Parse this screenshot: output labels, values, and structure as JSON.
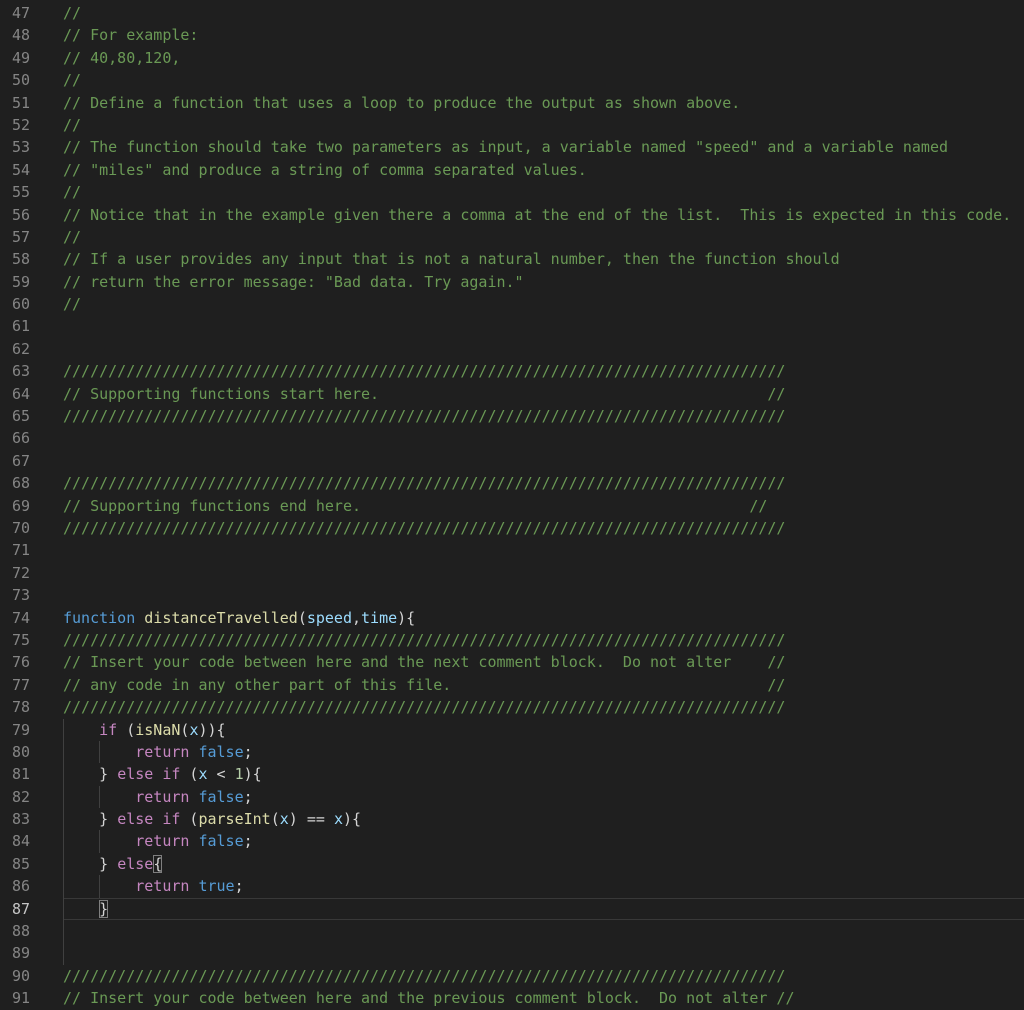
{
  "editor": {
    "language": "javascript",
    "active_line": 87,
    "colors": {
      "comment": "#6A9955",
      "kw": "#C586C0",
      "kw2": "#569CD6",
      "fn": "#DCDCAA",
      "var": "#9CDCFE",
      "num": "#B5CEA8",
      "punct": "#D4D4D4",
      "background": "#1F1F1F",
      "line_number": "#858585",
      "line_number_active": "#C6C6C6",
      "indent_guide": "#404040",
      "current_line_border": "#383838",
      "bracket_match_border": "#7F7F7F"
    },
    "first_visible_line": 47,
    "last_visible_line": 91,
    "lines": [
      {
        "n": 47,
        "g": [],
        "segs": [
          {
            "t": "//",
            "c": "comment"
          }
        ]
      },
      {
        "n": 48,
        "g": [],
        "segs": [
          {
            "t": "// For example:",
            "c": "comment"
          }
        ]
      },
      {
        "n": 49,
        "g": [],
        "segs": [
          {
            "t": "// 40,80,120,",
            "c": "comment"
          }
        ]
      },
      {
        "n": 50,
        "g": [],
        "segs": [
          {
            "t": "//",
            "c": "comment"
          }
        ]
      },
      {
        "n": 51,
        "g": [],
        "segs": [
          {
            "t": "// Define a function that uses a loop to produce the output as shown above.",
            "c": "comment"
          }
        ]
      },
      {
        "n": 52,
        "g": [],
        "segs": [
          {
            "t": "//",
            "c": "comment"
          }
        ]
      },
      {
        "n": 53,
        "g": [],
        "segs": [
          {
            "t": "// The function should take two parameters as input, a variable named \"speed\" and a variable named",
            "c": "comment"
          }
        ]
      },
      {
        "n": 54,
        "g": [],
        "segs": [
          {
            "t": "// \"miles\" and produce a string of comma separated values.",
            "c": "comment"
          }
        ]
      },
      {
        "n": 55,
        "g": [],
        "segs": [
          {
            "t": "//",
            "c": "comment"
          }
        ]
      },
      {
        "n": 56,
        "g": [],
        "segs": [
          {
            "t": "// Notice that in the example given there a comma at the end of the list.  This is expected in this code.",
            "c": "comment"
          }
        ]
      },
      {
        "n": 57,
        "g": [],
        "segs": [
          {
            "t": "//",
            "c": "comment"
          }
        ]
      },
      {
        "n": 58,
        "g": [],
        "segs": [
          {
            "t": "// If a user provides any input that is not a natural number, then the function should",
            "c": "comment"
          }
        ]
      },
      {
        "n": 59,
        "g": [],
        "segs": [
          {
            "t": "// return the error message: \"Bad data. Try again.\"",
            "c": "comment"
          }
        ]
      },
      {
        "n": 60,
        "g": [],
        "segs": [
          {
            "t": "//",
            "c": "comment"
          }
        ]
      },
      {
        "n": 61,
        "g": [],
        "segs": []
      },
      {
        "n": 62,
        "g": [],
        "segs": []
      },
      {
        "n": 63,
        "g": [],
        "segs": [
          {
            "t": "////////////////////////////////////////////////////////////////////////////////",
            "c": "comment"
          }
        ]
      },
      {
        "n": 64,
        "g": [],
        "segs": [
          {
            "t": "// Supporting functions start here.                                           //",
            "c": "comment"
          }
        ]
      },
      {
        "n": 65,
        "g": [],
        "segs": [
          {
            "t": "////////////////////////////////////////////////////////////////////////////////",
            "c": "comment"
          }
        ]
      },
      {
        "n": 66,
        "g": [],
        "segs": []
      },
      {
        "n": 67,
        "g": [],
        "segs": []
      },
      {
        "n": 68,
        "g": [],
        "segs": [
          {
            "t": "////////////////////////////////////////////////////////////////////////////////",
            "c": "comment"
          }
        ]
      },
      {
        "n": 69,
        "g": [],
        "segs": [
          {
            "t": "// Supporting functions end here.                                           //",
            "c": "comment"
          }
        ]
      },
      {
        "n": 70,
        "g": [],
        "segs": [
          {
            "t": "////////////////////////////////////////////////////////////////////////////////",
            "c": "comment"
          }
        ]
      },
      {
        "n": 71,
        "g": [],
        "segs": []
      },
      {
        "n": 72,
        "g": [],
        "segs": []
      },
      {
        "n": 73,
        "g": [],
        "segs": []
      },
      {
        "n": 74,
        "g": [],
        "segs": [
          {
            "t": "function",
            "c": "kw2"
          },
          {
            "t": " ",
            "c": "punct"
          },
          {
            "t": "distanceTravelled",
            "c": "fn"
          },
          {
            "t": "(",
            "c": "punct"
          },
          {
            "t": "speed",
            "c": "var"
          },
          {
            "t": ",",
            "c": "punct"
          },
          {
            "t": "time",
            "c": "var"
          },
          {
            "t": "){",
            "c": "punct"
          }
        ]
      },
      {
        "n": 75,
        "g": [],
        "segs": [
          {
            "t": "////////////////////////////////////////////////////////////////////////////////",
            "c": "comment"
          }
        ]
      },
      {
        "n": 76,
        "g": [],
        "segs": [
          {
            "t": "// Insert your code between here and the next comment block.  Do not alter    //",
            "c": "comment"
          }
        ]
      },
      {
        "n": 77,
        "g": [],
        "segs": [
          {
            "t": "// any code in any other part of this file.                                   //",
            "c": "comment"
          }
        ]
      },
      {
        "n": 78,
        "g": [],
        "segs": [
          {
            "t": "////////////////////////////////////////////////////////////////////////////////",
            "c": "comment"
          }
        ]
      },
      {
        "n": 79,
        "g": [
          0
        ],
        "segs": [
          {
            "t": "    ",
            "c": "punct"
          },
          {
            "t": "if",
            "c": "kw"
          },
          {
            "t": " (",
            "c": "punct"
          },
          {
            "t": "isNaN",
            "c": "fn"
          },
          {
            "t": "(",
            "c": "punct"
          },
          {
            "t": "x",
            "c": "var"
          },
          {
            "t": ")){",
            "c": "punct"
          }
        ]
      },
      {
        "n": 80,
        "g": [
          0,
          4
        ],
        "segs": [
          {
            "t": "        ",
            "c": "punct"
          },
          {
            "t": "return",
            "c": "kw"
          },
          {
            "t": " ",
            "c": "punct"
          },
          {
            "t": "false",
            "c": "kw2"
          },
          {
            "t": ";",
            "c": "punct"
          }
        ]
      },
      {
        "n": 81,
        "g": [
          0
        ],
        "segs": [
          {
            "t": "    } ",
            "c": "punct"
          },
          {
            "t": "else",
            "c": "kw"
          },
          {
            "t": " ",
            "c": "punct"
          },
          {
            "t": "if",
            "c": "kw"
          },
          {
            "t": " (",
            "c": "punct"
          },
          {
            "t": "x",
            "c": "var"
          },
          {
            "t": " < ",
            "c": "punct"
          },
          {
            "t": "1",
            "c": "num"
          },
          {
            "t": "){",
            "c": "punct"
          }
        ]
      },
      {
        "n": 82,
        "g": [
          0,
          4
        ],
        "segs": [
          {
            "t": "        ",
            "c": "punct"
          },
          {
            "t": "return",
            "c": "kw"
          },
          {
            "t": " ",
            "c": "punct"
          },
          {
            "t": "false",
            "c": "kw2"
          },
          {
            "t": ";",
            "c": "punct"
          }
        ]
      },
      {
        "n": 83,
        "g": [
          0
        ],
        "segs": [
          {
            "t": "    } ",
            "c": "punct"
          },
          {
            "t": "else",
            "c": "kw"
          },
          {
            "t": " ",
            "c": "punct"
          },
          {
            "t": "if",
            "c": "kw"
          },
          {
            "t": " (",
            "c": "punct"
          },
          {
            "t": "parseInt",
            "c": "fn"
          },
          {
            "t": "(",
            "c": "punct"
          },
          {
            "t": "x",
            "c": "var"
          },
          {
            "t": ") == ",
            "c": "punct"
          },
          {
            "t": "x",
            "c": "var"
          },
          {
            "t": "){",
            "c": "punct"
          }
        ]
      },
      {
        "n": 84,
        "g": [
          0,
          4
        ],
        "segs": [
          {
            "t": "        ",
            "c": "punct"
          },
          {
            "t": "return",
            "c": "kw"
          },
          {
            "t": " ",
            "c": "punct"
          },
          {
            "t": "false",
            "c": "kw2"
          },
          {
            "t": ";",
            "c": "punct"
          }
        ]
      },
      {
        "n": 85,
        "g": [
          0
        ],
        "segs": [
          {
            "t": "    } ",
            "c": "punct"
          },
          {
            "t": "else",
            "c": "kw"
          },
          {
            "t": "{",
            "c": "punct",
            "box": true
          }
        ]
      },
      {
        "n": 86,
        "g": [
          0,
          4
        ],
        "segs": [
          {
            "t": "        ",
            "c": "punct"
          },
          {
            "t": "return",
            "c": "kw"
          },
          {
            "t": " ",
            "c": "punct"
          },
          {
            "t": "true",
            "c": "kw2"
          },
          {
            "t": ";",
            "c": "punct"
          }
        ]
      },
      {
        "n": 87,
        "g": [
          0
        ],
        "segs": [
          {
            "t": "    ",
            "c": "punct"
          },
          {
            "t": "}",
            "c": "punct",
            "box": true
          }
        ]
      },
      {
        "n": 88,
        "g": [
          0
        ],
        "segs": []
      },
      {
        "n": 89,
        "g": [
          0
        ],
        "segs": []
      },
      {
        "n": 90,
        "g": [],
        "segs": [
          {
            "t": "////////////////////////////////////////////////////////////////////////////////",
            "c": "comment"
          }
        ]
      },
      {
        "n": 91,
        "g": [],
        "segs": [
          {
            "t": "// Insert your code between here and the previous comment block.  Do not alter //",
            "c": "comment"
          }
        ]
      }
    ]
  }
}
